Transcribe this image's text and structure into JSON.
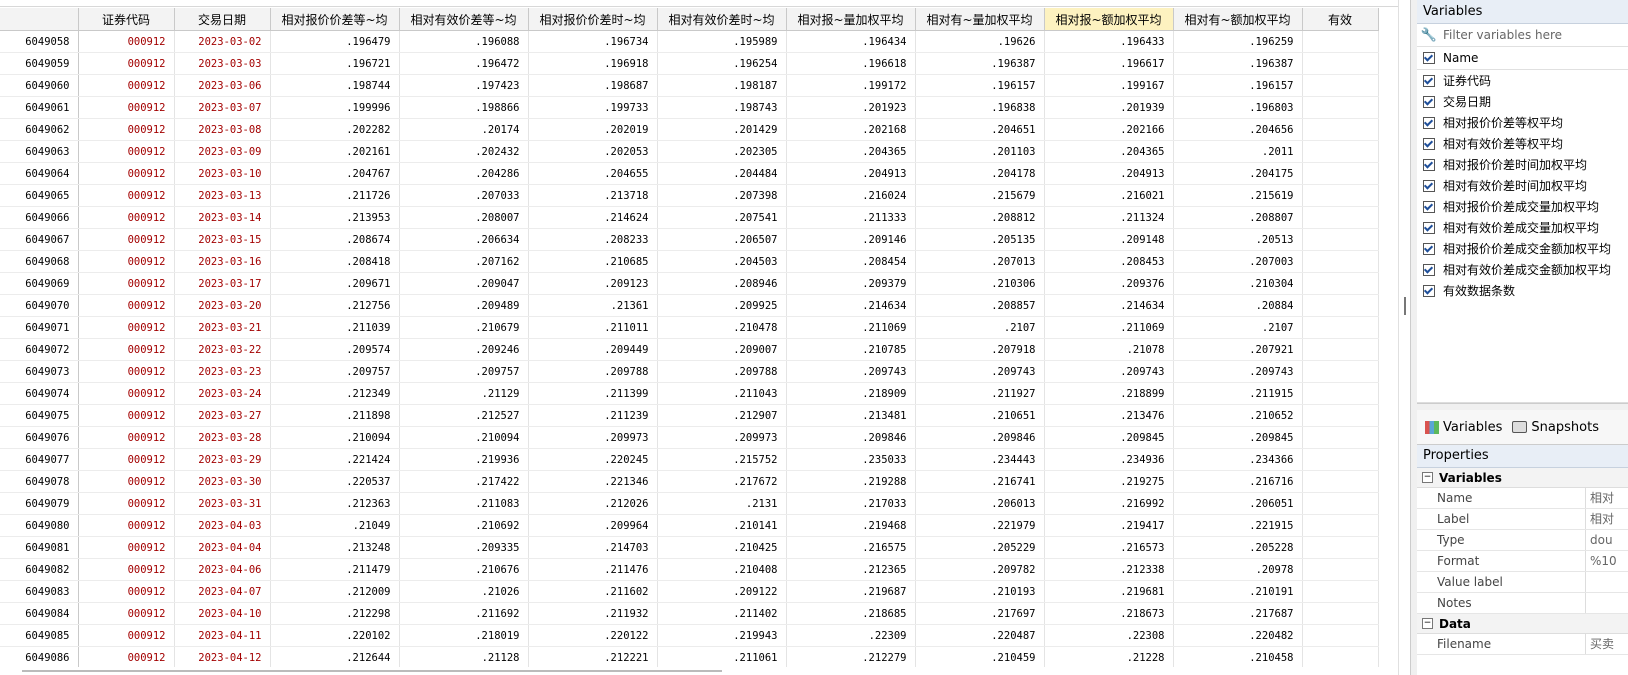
{
  "grid": {
    "headers": [
      "",
      "证券代码",
      "交易日期",
      "相对报价价差等~均",
      "相对有效价差等~均",
      "相对报价价差时~均",
      "相对有效价差时~均",
      "相对报~量加权平均",
      "相对有~量加权平均",
      "相对报~额加权平均",
      "相对有~额加权平均",
      "有效"
    ],
    "rows": [
      [
        "6049058",
        "000912",
        "2023-03-02",
        ".196479",
        ".196088",
        ".196734",
        ".195989",
        ".196434",
        ".19626",
        ".196433",
        ".196259"
      ],
      [
        "6049059",
        "000912",
        "2023-03-03",
        ".196721",
        ".196472",
        ".196918",
        ".196254",
        ".196618",
        ".196387",
        ".196617",
        ".196387"
      ],
      [
        "6049060",
        "000912",
        "2023-03-06",
        ".198744",
        ".197423",
        ".198687",
        ".198187",
        ".199172",
        ".196157",
        ".199167",
        ".196157"
      ],
      [
        "6049061",
        "000912",
        "2023-03-07",
        ".199996",
        ".198866",
        ".199733",
        ".198743",
        ".201923",
        ".196838",
        ".201939",
        ".196803"
      ],
      [
        "6049062",
        "000912",
        "2023-03-08",
        ".202282",
        ".20174",
        ".202019",
        ".201429",
        ".202168",
        ".204651",
        ".202166",
        ".204656"
      ],
      [
        "6049063",
        "000912",
        "2023-03-09",
        ".202161",
        ".202432",
        ".202053",
        ".202305",
        ".204365",
        ".201103",
        ".204365",
        ".2011"
      ],
      [
        "6049064",
        "000912",
        "2023-03-10",
        ".204767",
        ".204286",
        ".204655",
        ".204484",
        ".204913",
        ".204178",
        ".204913",
        ".204175"
      ],
      [
        "6049065",
        "000912",
        "2023-03-13",
        ".211726",
        ".207033",
        ".213718",
        ".207398",
        ".216024",
        ".215679",
        ".216021",
        ".215619"
      ],
      [
        "6049066",
        "000912",
        "2023-03-14",
        ".213953",
        ".208007",
        ".214624",
        ".207541",
        ".211333",
        ".208812",
        ".211324",
        ".208807"
      ],
      [
        "6049067",
        "000912",
        "2023-03-15",
        ".208674",
        ".206634",
        ".208233",
        ".206507",
        ".209146",
        ".205135",
        ".209148",
        ".20513"
      ],
      [
        "6049068",
        "000912",
        "2023-03-16",
        ".208418",
        ".207162",
        ".210685",
        ".204503",
        ".208454",
        ".207013",
        ".208453",
        ".207003"
      ],
      [
        "6049069",
        "000912",
        "2023-03-17",
        ".209671",
        ".209047",
        ".209123",
        ".208946",
        ".209379",
        ".210306",
        ".209376",
        ".210304"
      ],
      [
        "6049070",
        "000912",
        "2023-03-20",
        ".212756",
        ".209489",
        ".21361",
        ".209925",
        ".214634",
        ".208857",
        ".214634",
        ".20884"
      ],
      [
        "6049071",
        "000912",
        "2023-03-21",
        ".211039",
        ".210679",
        ".211011",
        ".210478",
        ".211069",
        ".2107",
        ".211069",
        ".2107"
      ],
      [
        "6049072",
        "000912",
        "2023-03-22",
        ".209574",
        ".209246",
        ".209449",
        ".209007",
        ".210785",
        ".207918",
        ".21078",
        ".207921"
      ],
      [
        "6049073",
        "000912",
        "2023-03-23",
        ".209757",
        ".209757",
        ".209788",
        ".209788",
        ".209743",
        ".209743",
        ".209743",
        ".209743"
      ],
      [
        "6049074",
        "000912",
        "2023-03-24",
        ".212349",
        ".21129",
        ".211399",
        ".211043",
        ".218909",
        ".211927",
        ".218899",
        ".211915"
      ],
      [
        "6049075",
        "000912",
        "2023-03-27",
        ".211898",
        ".212527",
        ".211239",
        ".212907",
        ".213481",
        ".210651",
        ".213476",
        ".210652"
      ],
      [
        "6049076",
        "000912",
        "2023-03-28",
        ".210094",
        ".210094",
        ".209973",
        ".209973",
        ".209846",
        ".209846",
        ".209845",
        ".209845"
      ],
      [
        "6049077",
        "000912",
        "2023-03-29",
        ".221424",
        ".219936",
        ".220245",
        ".215752",
        ".235033",
        ".234443",
        ".234936",
        ".234366"
      ],
      [
        "6049078",
        "000912",
        "2023-03-30",
        ".220537",
        ".217422",
        ".221346",
        ".217672",
        ".219288",
        ".216741",
        ".219275",
        ".216716"
      ],
      [
        "6049079",
        "000912",
        "2023-03-31",
        ".212363",
        ".211083",
        ".212026",
        ".2131",
        ".217033",
        ".206013",
        ".216992",
        ".206051"
      ],
      [
        "6049080",
        "000912",
        "2023-04-03",
        ".21049",
        ".210692",
        ".209964",
        ".210141",
        ".219468",
        ".221979",
        ".219417",
        ".221915"
      ],
      [
        "6049081",
        "000912",
        "2023-04-04",
        ".213248",
        ".209335",
        ".214703",
        ".210425",
        ".216575",
        ".205229",
        ".216573",
        ".205228"
      ],
      [
        "6049082",
        "000912",
        "2023-04-06",
        ".211479",
        ".210676",
        ".211476",
        ".210408",
        ".212365",
        ".209782",
        ".212338",
        ".20978"
      ],
      [
        "6049083",
        "000912",
        "2023-04-07",
        ".212009",
        ".21026",
        ".211602",
        ".209122",
        ".219687",
        ".210193",
        ".219681",
        ".210191"
      ],
      [
        "6049084",
        "000912",
        "2023-04-10",
        ".212298",
        ".211692",
        ".211932",
        ".211402",
        ".218685",
        ".217697",
        ".218673",
        ".217687"
      ],
      [
        "6049085",
        "000912",
        "2023-04-11",
        ".220102",
        ".218019",
        ".220122",
        ".219943",
        ".22309",
        ".220487",
        ".22308",
        ".220482"
      ],
      [
        "6049086",
        "000912",
        "2023-04-12",
        ".212644",
        ".21128",
        ".212221",
        ".211061",
        ".212279",
        ".210459",
        ".21228",
        ".210458"
      ]
    ]
  },
  "variables_panel": {
    "title": "Variables",
    "filter_placeholder": "Filter variables here",
    "name_header": "Name",
    "items": [
      "证券代码",
      "交易日期",
      "相对报价价差等权平均",
      "相对有效价差等权平均",
      "相对报价价差时间加权平均",
      "相对有效价差时间加权平均",
      "相对报价价差成交量加权平均",
      "相对有效价差成交量加权平均",
      "相对报价价差成交金额加权平均",
      "相对有效价差成交金额加权平均",
      "有效数据条数"
    ]
  },
  "tabs": {
    "variables": "Variables",
    "snapshots": "Snapshots"
  },
  "properties": {
    "title": "Properties",
    "section_variables": "Variables",
    "rows": [
      {
        "k": "Name",
        "v": "相对"
      },
      {
        "k": "Label",
        "v": "相对"
      },
      {
        "k": "Type",
        "v": "dou"
      },
      {
        "k": "Format",
        "v": "%10"
      },
      {
        "k": "Value label",
        "v": ""
      },
      {
        "k": "Notes",
        "v": ""
      }
    ],
    "section_data": "Data",
    "data_rows": [
      {
        "k": "Filename",
        "v": "买卖"
      }
    ]
  },
  "colors": {
    "code_red": "#a30000",
    "selected_header": "#fdf2c0"
  }
}
